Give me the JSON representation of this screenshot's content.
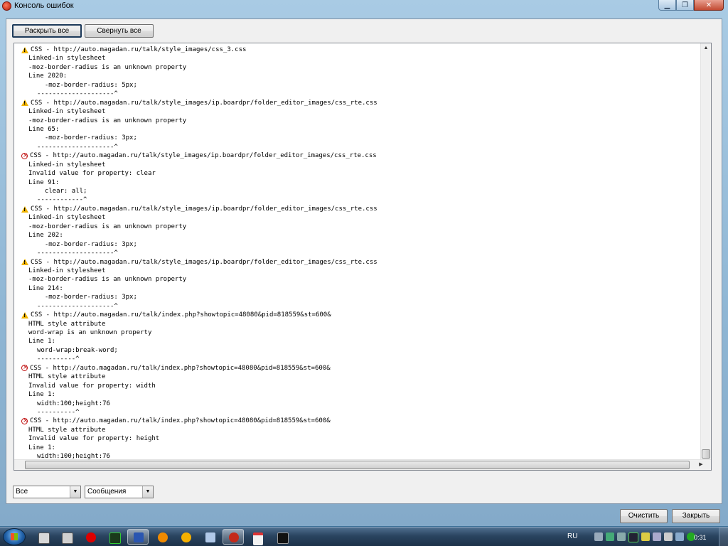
{
  "window": {
    "title": "Консоль ошибок"
  },
  "toolbar": {
    "expand_all": "Раскрыть все",
    "collapse_all": "Свернуть все"
  },
  "entries": [
    {
      "type": "warning",
      "header": "CSS - http://auto.magadan.ru/talk/style_images/css_3.css",
      "source": "Linked-in stylesheet",
      "message": "-moz-border-radius is an unknown property",
      "line": "Line 2020:",
      "code": "  -moz-border-radius: 5px;",
      "marker": "--------------------^"
    },
    {
      "type": "warning",
      "header": "CSS - http://auto.magadan.ru/talk/style_images/ip.boardpr/folder_editor_images/css_rte.css",
      "source": "Linked-in stylesheet",
      "message": "-moz-border-radius is an unknown property",
      "line": "Line 65:",
      "code": "  -moz-border-radius: 3px;",
      "marker": "--------------------^"
    },
    {
      "type": "error",
      "header": "CSS - http://auto.magadan.ru/talk/style_images/ip.boardpr/folder_editor_images/css_rte.css",
      "source": "Linked-in stylesheet",
      "message": "Invalid value for property: clear",
      "line": "Line 91:",
      "code": "  clear: all;",
      "marker": "------------^"
    },
    {
      "type": "warning",
      "header": "CSS - http://auto.magadan.ru/talk/style_images/ip.boardpr/folder_editor_images/css_rte.css",
      "source": "Linked-in stylesheet",
      "message": "-moz-border-radius is an unknown property",
      "line": "Line 202:",
      "code": "  -moz-border-radius: 3px;",
      "marker": "--------------------^"
    },
    {
      "type": "warning",
      "header": "CSS - http://auto.magadan.ru/talk/style_images/ip.boardpr/folder_editor_images/css_rte.css",
      "source": "Linked-in stylesheet",
      "message": "-moz-border-radius is an unknown property",
      "line": "Line 214:",
      "code": "  -moz-border-radius: 3px;",
      "marker": "--------------------^"
    },
    {
      "type": "warning",
      "header": "CSS - http://auto.magadan.ru/talk/index.php?showtopic=48080&pid=818559&st=600&",
      "source": "HTML style attribute",
      "message": "word-wrap is an unknown property",
      "line": "Line 1:",
      "code": "word-wrap:break-word;",
      "marker": "----------^"
    },
    {
      "type": "error",
      "header": "CSS - http://auto.magadan.ru/talk/index.php?showtopic=48080&pid=818559&st=600&",
      "source": "HTML style attribute",
      "message": "Invalid value for property: width",
      "line": "Line 1:",
      "code": "width:100;height:76",
      "marker": "----------^"
    },
    {
      "type": "error",
      "header": "CSS - http://auto.magadan.ru/talk/index.php?showtopic=48080&pid=818559&st=600&",
      "source": "HTML style attribute",
      "message": "Invalid value for property: height",
      "line": "Line 1:",
      "code": "width:100;height:76",
      "marker": "--------------------^"
    }
  ],
  "filters": {
    "scope_value": "Все",
    "type_value": "Сообщения"
  },
  "footer": {
    "clear": "Очистить",
    "close": "Закрыть"
  },
  "taskbar": {
    "language": "RU",
    "clock": "0:31"
  },
  "colors": {
    "warning": "#f0b400",
    "error": "#c01010",
    "title_bar": "#a9cbe4"
  },
  "icons": {
    "warning": "warning-triangle-icon",
    "error": "error-x-circle-icon"
  }
}
